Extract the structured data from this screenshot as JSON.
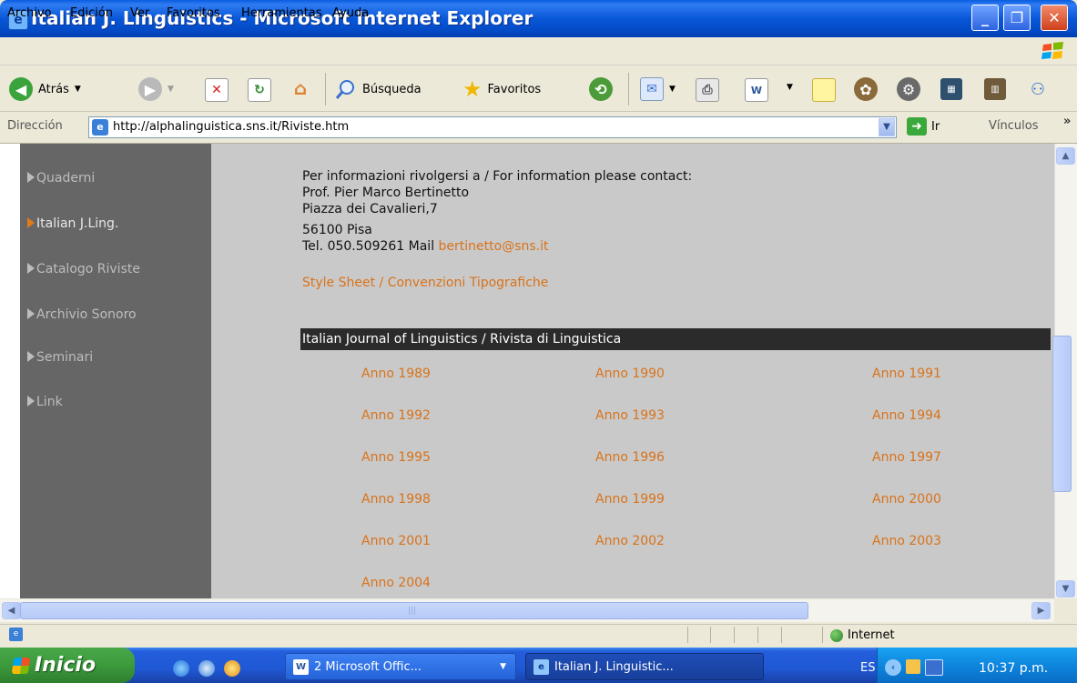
{
  "window": {
    "title": "Italian J. Linguistics - Microsoft Internet Explorer"
  },
  "menu": [
    "Archivo",
    "Edición",
    "Ver",
    "Favoritos",
    "Herramientas",
    "Ayuda"
  ],
  "toolbar": {
    "back_label": "Atrás",
    "search_label": "Búsqueda",
    "favorites_label": "Favoritos"
  },
  "address": {
    "label": "Dirección",
    "url": "http://alphalinguistica.sns.it/Riviste.htm",
    "go_label": "Ir",
    "links_label": "Vínculos"
  },
  "sidebar": {
    "items": [
      {
        "label": "Quaderni",
        "active": false
      },
      {
        "label": "Italian J.Ling.",
        "active": true
      },
      {
        "label": "Catalogo Riviste",
        "active": false
      },
      {
        "label": "Archivio Sonoro",
        "active": false
      },
      {
        "label": "Seminari",
        "active": false
      },
      {
        "label": "Link",
        "active": false
      }
    ]
  },
  "content": {
    "contact_intro": "Per informazioni rivolgersi a / For information please contact:",
    "name": "Prof. Pier Marco Bertinetto",
    "street": "Piazza dei Cavalieri,7",
    "city": "56100 Pisa",
    "tel_mail_prefix": "Tel. 050.509261 Mail",
    "email": "bertinetto@sns.it",
    "style_sheet_link": "Style Sheet / Convenzioni Tipografiche",
    "journal_header": "Italian Journal of Linguistics / Rivista di Linguistica",
    "years": [
      [
        "Anno 1989",
        "Anno 1990",
        "Anno 1991"
      ],
      [
        "Anno 1992",
        "Anno 1993",
        "Anno 1994"
      ],
      [
        "Anno 1995",
        "Anno 1996",
        "Anno 1997"
      ],
      [
        "Anno 1998",
        "Anno 1999",
        "Anno 2000"
      ],
      [
        "Anno 2001",
        "Anno 2002",
        "Anno 2003"
      ],
      [
        "Anno 2004"
      ]
    ]
  },
  "status": {
    "zone": "Internet"
  },
  "taskbar": {
    "start_label": "Inicio",
    "tasks": [
      {
        "label": "2 Microsoft Offic...",
        "icon": "word-icon"
      },
      {
        "label": "Italian J. Linguistic...",
        "icon": "ie-icon"
      }
    ],
    "language": "ES",
    "clock": "10:37 p.m."
  },
  "colors": {
    "link": "#D9731A",
    "sidebar_bg": "#666666",
    "content_bg": "#C9C9C9",
    "header_bg": "#2B2B2B"
  }
}
